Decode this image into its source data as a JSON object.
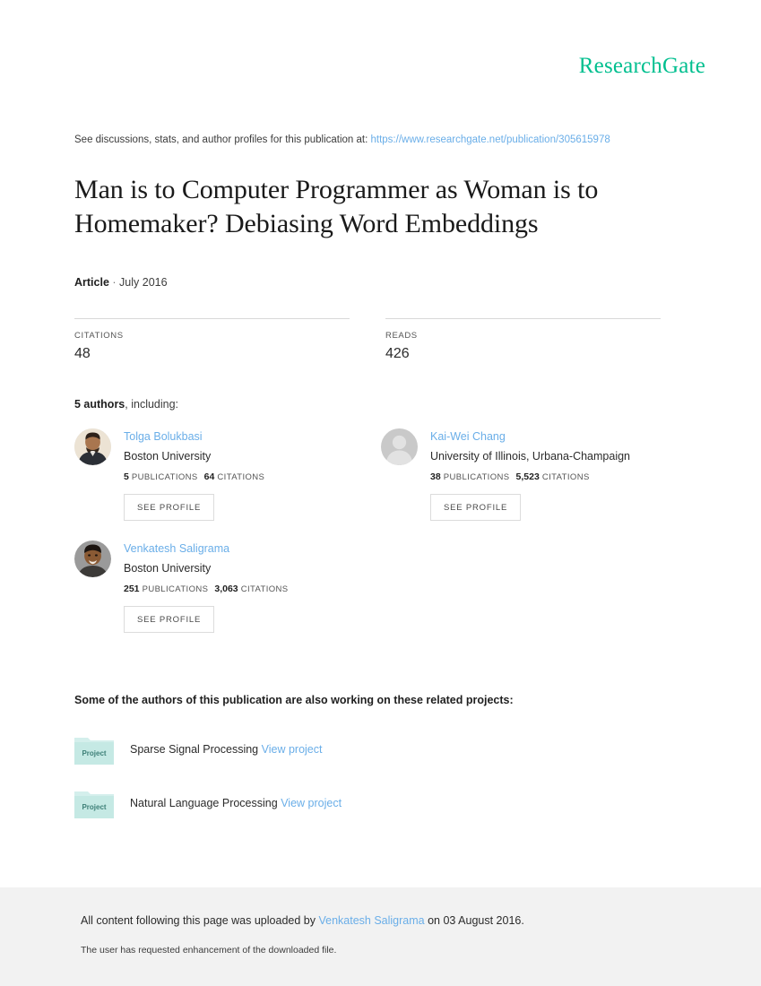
{
  "brand": {
    "logo_text": "ResearchGate",
    "logo_color": "#00bf8f",
    "link_color": "#6aaee8"
  },
  "header": {
    "discussion_prefix": "See discussions, stats, and author profiles for this publication at:",
    "publication_url": "https://www.researchgate.net/publication/305615978"
  },
  "publication": {
    "title": "Man is to Computer Programmer as Woman is to Homemaker? Debiasing Word Embeddings",
    "type": "Article",
    "separator": "·",
    "date": "July 2016"
  },
  "metrics": [
    {
      "label": "CITATIONS",
      "value": "48"
    },
    {
      "label": "READS",
      "value": "426"
    }
  ],
  "authors_section": {
    "count_label": "5 authors",
    "count_suffix": ", including:",
    "see_profile_label": "SEE PROFILE",
    "publications_label": "PUBLICATIONS",
    "citations_label": "CITATIONS",
    "authors": [
      {
        "name": "Tolga Bolukbasi",
        "affiliation": "Boston University",
        "publications": "5",
        "citations": "64",
        "avatar": "photo-avatar"
      },
      {
        "name": "Kai-Wei Chang",
        "affiliation": "University of Illinois, Urbana-Champaign",
        "publications": "38",
        "citations": "5,523",
        "avatar": "placeholder-avatar"
      },
      {
        "name": "Venkatesh Saligrama",
        "affiliation": "Boston University",
        "publications": "251",
        "citations": "3,063",
        "avatar": "photo-avatar"
      }
    ]
  },
  "projects_section": {
    "heading": "Some of the authors of this publication are also working on these related projects:",
    "folder_icon_label": "Project",
    "view_link_label": "View project",
    "projects": [
      {
        "name": "Sparse Signal Processing"
      },
      {
        "name": "Natural Language Processing"
      }
    ]
  },
  "footer": {
    "upload_prefix": "All content following this page was uploaded by",
    "uploader": "Venkatesh Saligrama",
    "upload_suffix": "on 03 August 2016.",
    "enhancement_note": "The user has requested enhancement of the downloaded file."
  }
}
